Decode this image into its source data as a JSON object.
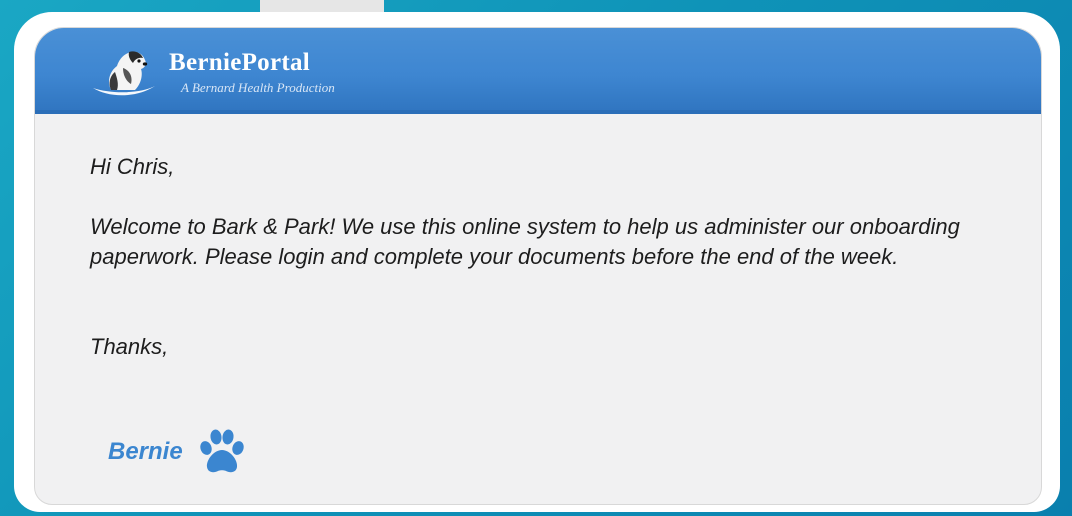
{
  "header": {
    "brand_title": "BerniePortal",
    "brand_subtitle": "A Bernard Health Production",
    "logo_icon": "dog-logo-icon"
  },
  "message": {
    "greeting": "Hi Chris,",
    "body": "Welcome to Bark & Park! We use this online system to help us administer our onboarding paperwork. Please login and complete your documents before the end of the week.",
    "closing": "Thanks,",
    "signature": "Bernie",
    "signature_icon": "paw-icon"
  },
  "colors": {
    "background": "#0f93b8",
    "header": "#3e86d1",
    "signature": "#3b86d0",
    "text": "#1d1d1d"
  }
}
